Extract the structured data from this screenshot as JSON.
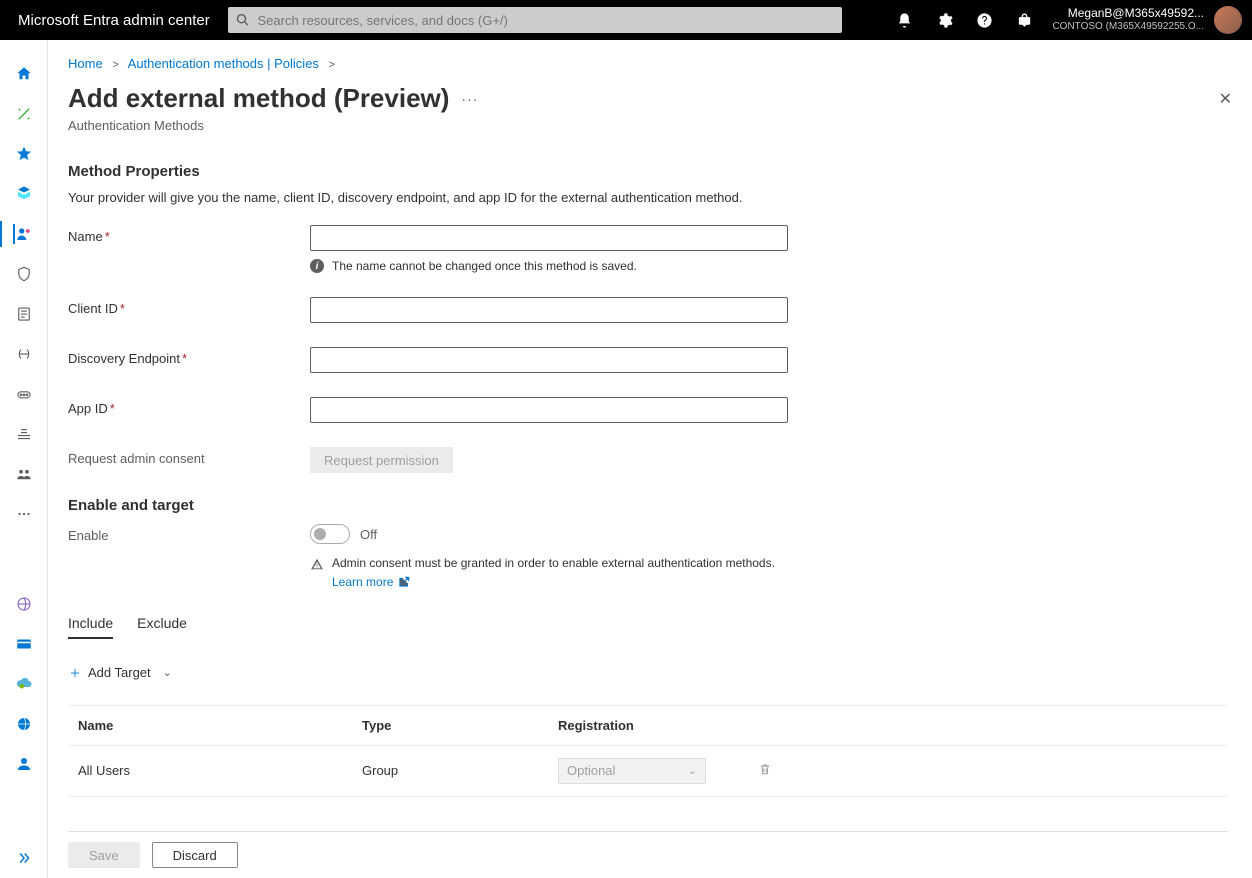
{
  "header": {
    "brand": "Microsoft Entra admin center",
    "search_placeholder": "Search resources, services, and docs (G+/)",
    "user": "MeganB@M365x49592...",
    "tenant": "CONTOSO (M365X49592255.O..."
  },
  "breadcrumbs": {
    "home": "Home",
    "auth": "Authentication methods | Policies"
  },
  "page": {
    "title": "Add external method (Preview)",
    "subtitle": "Authentication Methods"
  },
  "method_props": {
    "heading": "Method Properties",
    "desc": "Your provider will give you the name, client ID, discovery endpoint, and app ID for the external authentication method.",
    "name_label": "Name",
    "name_helper": "The name cannot be changed once this method is saved.",
    "client_id_label": "Client ID",
    "discovery_label": "Discovery Endpoint",
    "app_id_label": "App ID",
    "consent_label": "Request admin consent",
    "consent_btn": "Request permission"
  },
  "enable": {
    "heading": "Enable and target",
    "enable_label": "Enable",
    "toggle_state": "Off",
    "warn_text": "Admin consent must be granted in order to enable external authentication methods.",
    "learn_more": "Learn more"
  },
  "tabs": {
    "include": "Include",
    "exclude": "Exclude"
  },
  "add_target": "Add Target",
  "table": {
    "col_name": "Name",
    "col_type": "Type",
    "col_reg": "Registration",
    "rows": [
      {
        "name": "All Users",
        "type": "Group",
        "registration": "Optional"
      }
    ]
  },
  "footer": {
    "save": "Save",
    "discard": "Discard"
  }
}
